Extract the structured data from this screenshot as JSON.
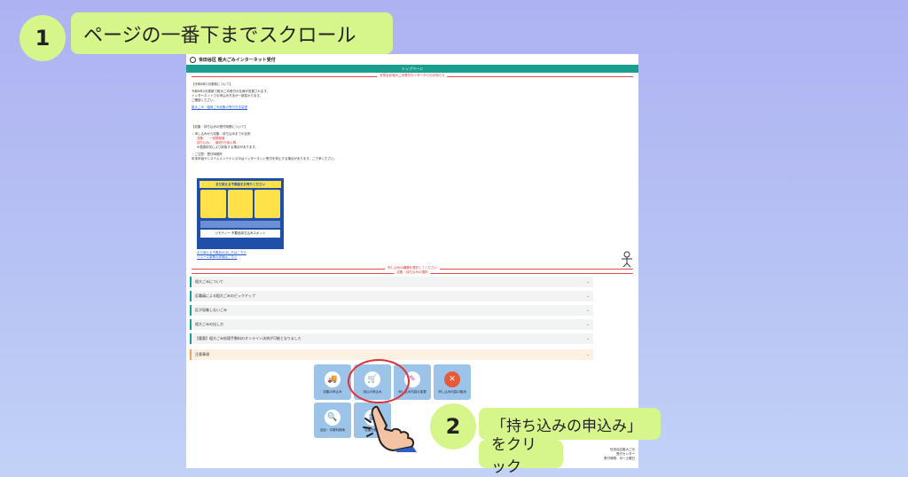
{
  "steps": {
    "step1": {
      "number": "1",
      "label": "ページの一番下までスクロール"
    },
    "step2": {
      "number": "2",
      "line1": "「持ち込みの申込み」",
      "line2": "をクリック"
    }
  },
  "site": {
    "title": "世田谷区 粗大ごみインターネット受付",
    "nav_bar": "トップページ",
    "red_notice": "世田谷区粗大ごみ受付センターからのお知らせ",
    "intro_heading": "【令和6年2月更新について】",
    "intro_lines": [
      "令和6年2月更新で粗大ごみ受付の仕様が変更されます。",
      "インターネットでの申込み方法が一部変わります。",
      "ご確認ください。"
    ],
    "intro_link": "粗大ごみ・臨時ごみ収集の受付方法変更",
    "hours_heading": "【収集・持ち込みの受付時間について】",
    "hours_lines": [
      "・申し込みから収集・持ち込みまでの目安",
      "収集：　一週間程度",
      "持ち込み：　最短3日後以降",
      "※混雑状況により前後する場合があります。"
    ],
    "bullet_lines": [
      "・ご注意：受付時間外",
      "年末年始やシステムメンテナンス中はインターネット受付を停止する場合があります。ご了承ください。"
    ],
    "banner": {
      "top": "まだ使える不要品をお売りください",
      "bottom": "ジモティー 不要品持ち込みスポット"
    },
    "below_banner_links": [
      "まだ使える不要品の出し方はこちら",
      "リユース事業の詳細はこちら"
    ],
    "divider_text_1": "申し込みの種類を選択してください",
    "divider_text_2": "収集・持ち込みの選択",
    "accordion": [
      {
        "label": "粗大ごみについて"
      },
      {
        "label": "区職員による粗大ごみのピックアップ"
      },
      {
        "label": "区が収集しないごみ"
      },
      {
        "label": "粗大ごみの出し方"
      },
      {
        "label": "【重要】粗大ごみ処理手数料のオンライン決済が可能となりました"
      },
      {
        "label": "注意事項"
      }
    ],
    "tiles": [
      {
        "label": "収集の申込み",
        "icon": "truck-icon"
      },
      {
        "label": "持込の申込み",
        "icon": "cart-icon"
      },
      {
        "label": "申し込み内容の変更",
        "icon": "pencil-icon"
      },
      {
        "label": "申し込み内容の取消",
        "icon": "cancel-icon"
      },
      {
        "label": "品目・手数料検索",
        "icon": "search-icon"
      },
      {
        "label": "収集日確認",
        "icon": "calendar-icon"
      }
    ],
    "footer_lines": [
      "世田谷区粗大ごみ",
      "受付センター",
      "受付時間：月～土曜日"
    ]
  },
  "colors": {
    "page_bg": "#b4bcf3",
    "callout": "#d6f58a",
    "accent": "#1a9e8f",
    "tile": "#9cc4e8",
    "highlight": "#e0303a"
  }
}
